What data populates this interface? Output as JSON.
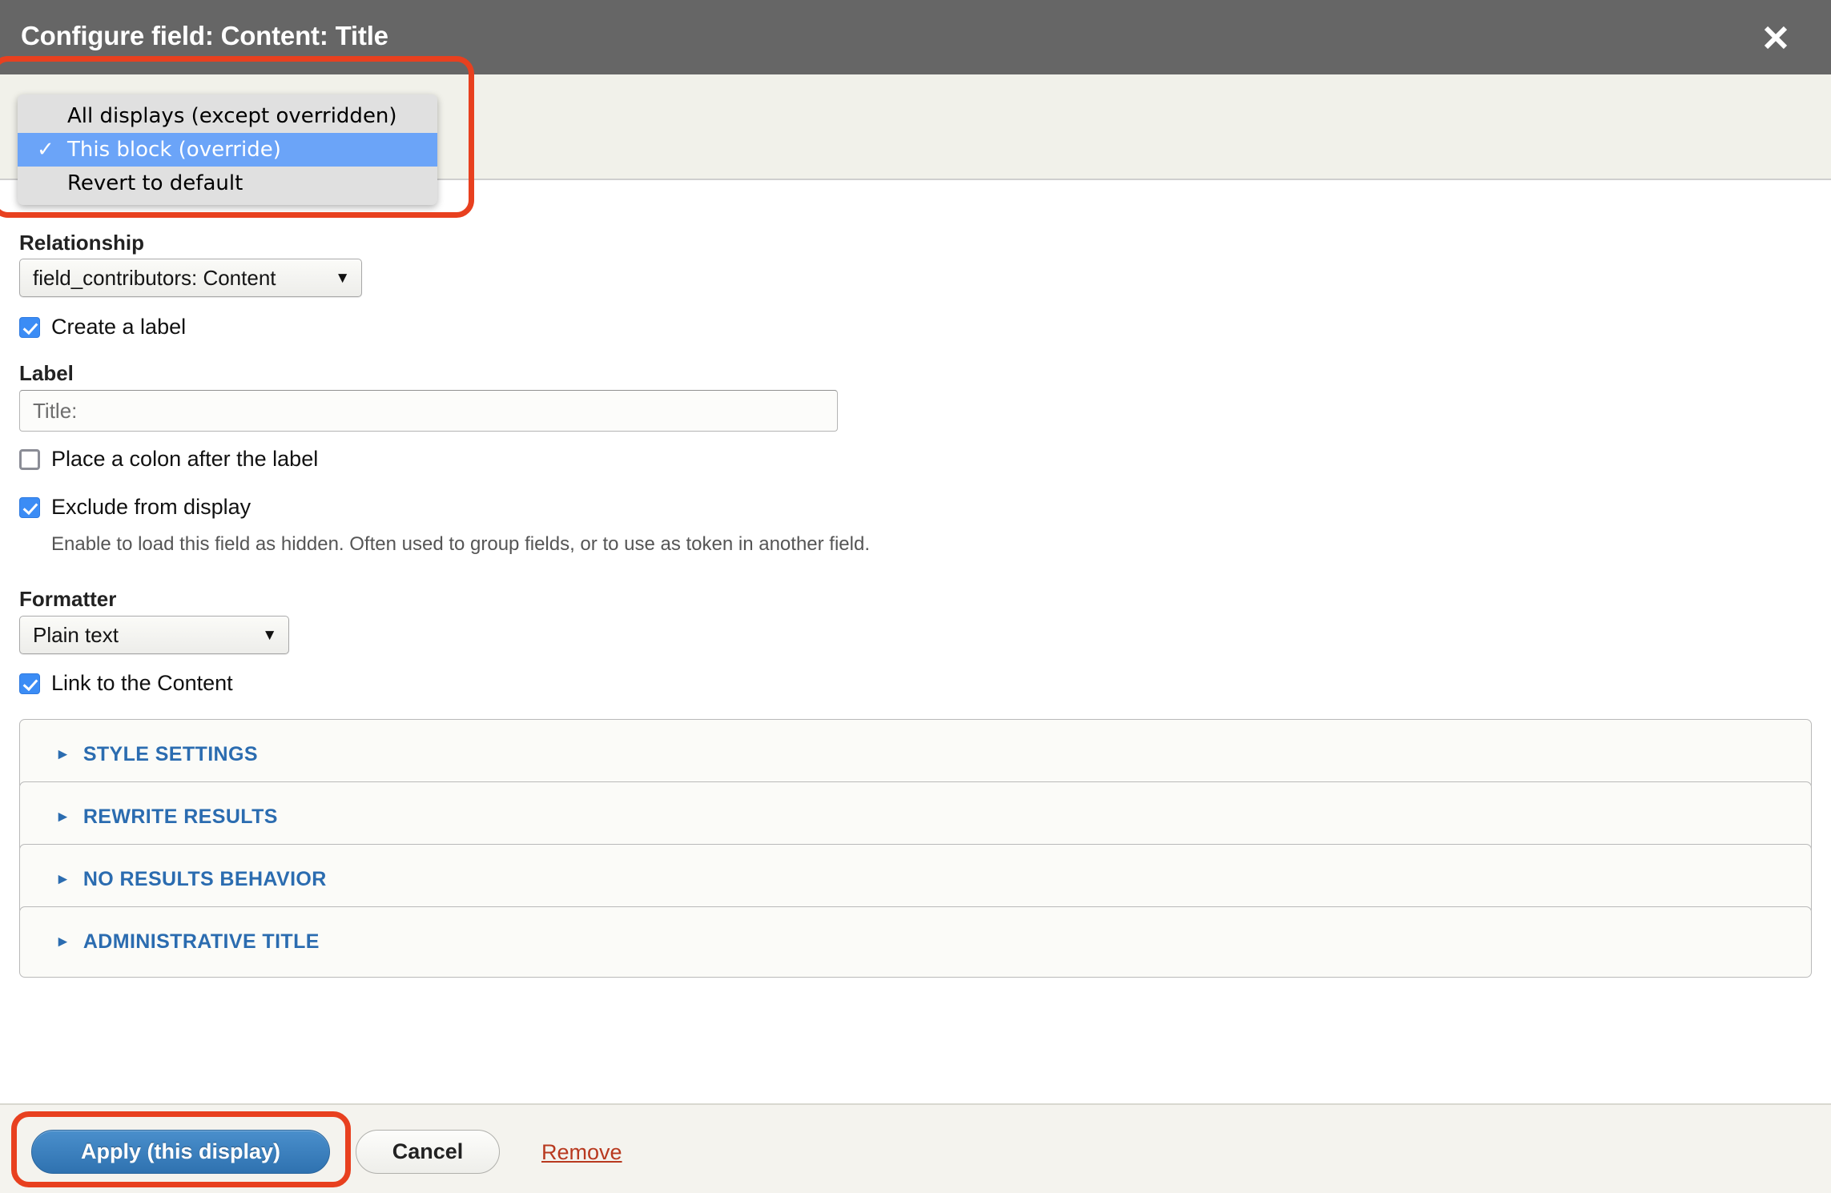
{
  "header": {
    "title": "Configure field: Content: Title",
    "close_icon": "close-icon"
  },
  "display_dropdown": {
    "open": true,
    "options": [
      {
        "label": "All displays (except overridden)",
        "selected": false
      },
      {
        "label": "This block (override)",
        "selected": true
      },
      {
        "label": "Revert to default",
        "selected": false
      }
    ],
    "check_glyph": "✓",
    "highlight_color": "#e8401f"
  },
  "form": {
    "relationship": {
      "label": "Relationship",
      "value": "field_contributors: Content",
      "caret": "▼"
    },
    "create_label": {
      "text": "Create a label",
      "checked": true
    },
    "label_field": {
      "label": "Label",
      "value": "Title:",
      "placeholder": "Title:"
    },
    "place_colon": {
      "text": "Place a colon after the label",
      "checked": false
    },
    "exclude_from_display": {
      "text": "Exclude from display",
      "checked": true,
      "description": "Enable to load this field as hidden. Often used to group fields, or to use as token in another field."
    },
    "formatter": {
      "label": "Formatter",
      "value": "Plain text",
      "caret": "▼"
    },
    "link_to_content": {
      "text": "Link to the Content",
      "checked": true
    },
    "panels": [
      {
        "title": "STYLE SETTINGS",
        "arrow": "►",
        "expanded": false
      },
      {
        "title": "REWRITE RESULTS",
        "arrow": "►",
        "expanded": false
      },
      {
        "title": "NO RESULTS BEHAVIOR",
        "arrow": "►",
        "expanded": false
      },
      {
        "title": "ADMINISTRATIVE TITLE",
        "arrow": "►",
        "expanded": false
      }
    ]
  },
  "footer": {
    "apply_label": "Apply (this display)",
    "cancel_label": "Cancel",
    "remove_label": "Remove"
  },
  "colors": {
    "header_bg": "#666666",
    "cream_band": "#f1f1ea",
    "footer_bg": "#f4f3ee",
    "accent_blue": "#2b6cb0",
    "apply_blue": "#2f72b0",
    "selected_blue": "#6ba4f8",
    "highlight_red": "#e8401f",
    "remove_red": "#b8391f"
  }
}
